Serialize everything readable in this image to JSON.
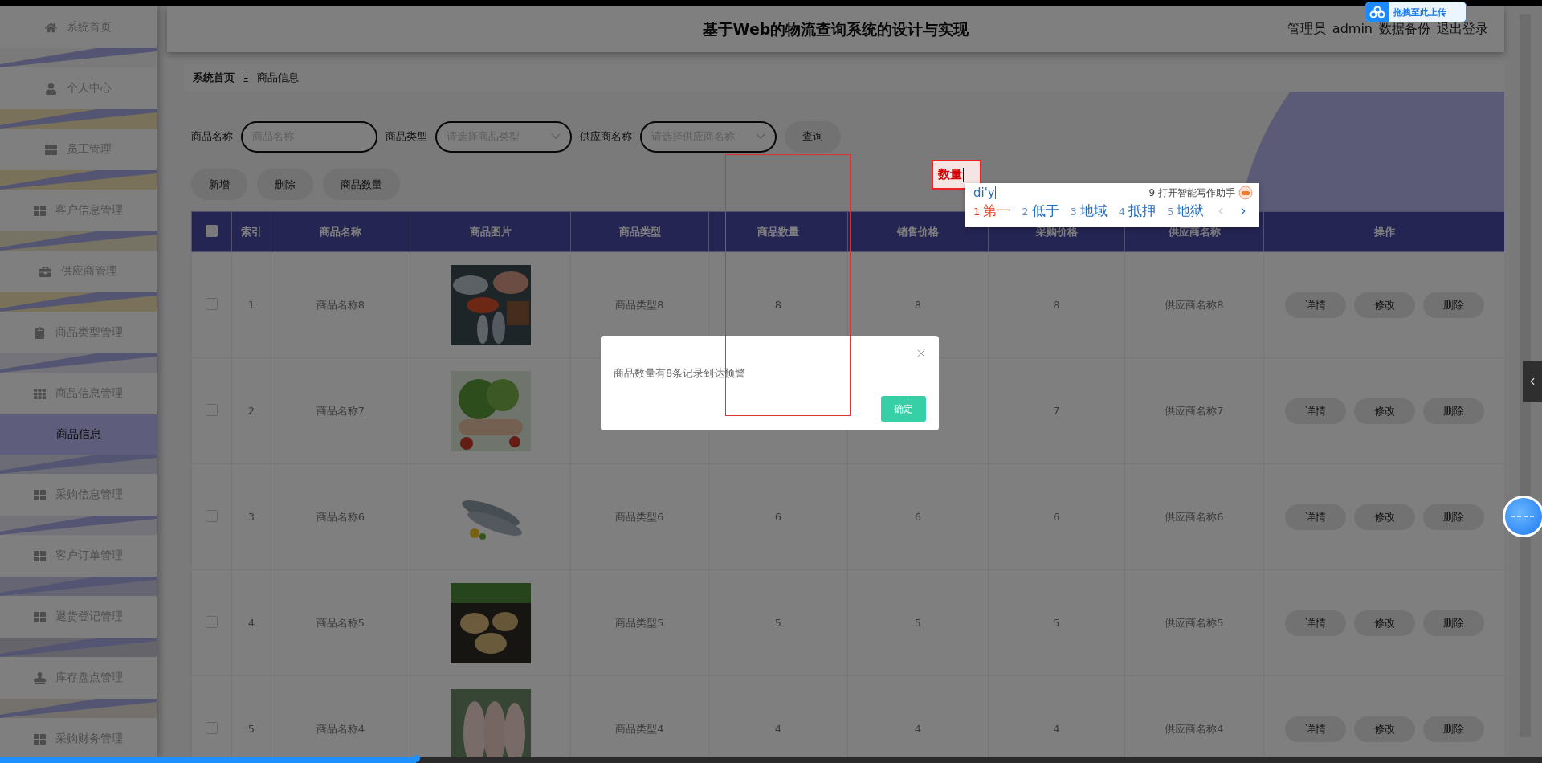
{
  "header": {
    "title": "基于Web的物流查询系统的设计与实现",
    "role": "管理员",
    "username": "admin",
    "links": [
      "数据备份",
      "退出登录"
    ]
  },
  "sidebar": {
    "items": [
      {
        "label": "系统首页",
        "selected": false
      },
      {
        "label": "个人中心",
        "selected": false
      },
      {
        "label": "员工管理",
        "selected": false
      },
      {
        "label": "客户信息管理",
        "selected": false
      },
      {
        "label": "供应商管理",
        "selected": false
      },
      {
        "label": "商品类型管理",
        "selected": false
      },
      {
        "label": "商品信息管理",
        "selected": false,
        "expanded": true,
        "children": [
          {
            "label": "商品信息",
            "selected": true
          }
        ]
      },
      {
        "label": "采购信息管理",
        "selected": false
      },
      {
        "label": "客户订单管理",
        "selected": false
      },
      {
        "label": "退货登记管理",
        "selected": false
      },
      {
        "label": "库存盘点管理",
        "selected": false
      },
      {
        "label": "采购财务管理",
        "selected": false
      }
    ]
  },
  "breadcrumb": {
    "items": [
      "系统首页",
      "商品信息"
    ],
    "separator": "Ξ"
  },
  "search": {
    "fields": [
      {
        "kind": "input",
        "label": "商品名称",
        "placeholder": "商品名称"
      },
      {
        "kind": "select",
        "label": "商品类型",
        "placeholder": "请选择商品类型"
      },
      {
        "kind": "select",
        "label": "供应商名称",
        "placeholder": "请选择供应商名称"
      }
    ],
    "submit": "查询"
  },
  "actions": [
    "新增",
    "删除",
    "商品数量"
  ],
  "table": {
    "select_all_checked": false,
    "columns": [
      "索引",
      "商品名称",
      "商品图片",
      "商品类型",
      "商品数量",
      "销售价格",
      "采购价格",
      "供应商名称",
      "操作"
    ],
    "rows": [
      {
        "checked": false,
        "index": "1",
        "name": "商品名称8",
        "type": "商品类型8",
        "quantity": "8",
        "sale_price": "8",
        "purchase_price": "8",
        "supplier": "供应商名称8",
        "actions": [
          "详情",
          "修改",
          "删除"
        ]
      },
      {
        "checked": false,
        "index": "2",
        "name": "商品名称7",
        "purchase_price": "7",
        "supplier": "供应商名称7",
        "actions": [
          "详情",
          "修改",
          "删除"
        ]
      },
      {
        "checked": false,
        "index": "3",
        "name": "商品名称6",
        "type": "商品类型6",
        "quantity": "6",
        "sale_price": "6",
        "purchase_price": "6",
        "supplier": "供应商名称6",
        "actions": [
          "详情",
          "修改",
          "删除"
        ]
      },
      {
        "checked": false,
        "index": "4",
        "name": "商品名称5",
        "type": "商品类型5",
        "quantity": "5",
        "sale_price": "5",
        "purchase_price": "5",
        "supplier": "供应商名称5",
        "actions": [
          "详情",
          "修改",
          "删除"
        ]
      },
      {
        "checked": false,
        "index": "5",
        "name": "商品名称4",
        "type": "商品类型4",
        "quantity": "4",
        "sale_price": "4",
        "purchase_price": "4",
        "supplier": "供应商名称4",
        "actions": [
          "详情",
          "修改",
          "删除"
        ]
      }
    ]
  },
  "dialog": {
    "message": "商品数量有8条记录到达预警",
    "confirm": "确定"
  },
  "ime": {
    "composition": "数量",
    "input": "di'y",
    "assistant": "9 打开智能写作助手",
    "candidates": [
      {
        "number": "1",
        "text": "第一",
        "selected": true
      },
      {
        "number": "2",
        "text": "低于",
        "selected": false
      },
      {
        "number": "3",
        "text": "地域",
        "selected": false
      },
      {
        "number": "4",
        "text": "抵押",
        "selected": false
      },
      {
        "number": "5",
        "text": "地狱",
        "selected": false
      }
    ]
  },
  "upload_widget": {
    "label": "拖拽至此上传"
  },
  "progress": {
    "level": 0.27
  }
}
